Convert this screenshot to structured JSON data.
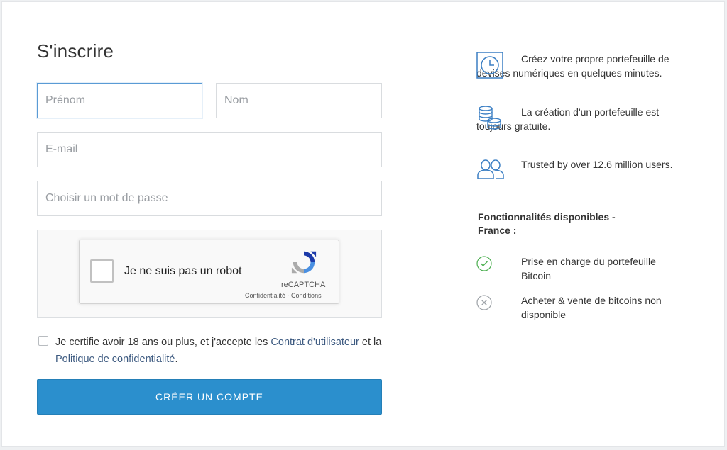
{
  "page": {
    "title": "S'inscrire"
  },
  "form": {
    "first_name_placeholder": "Prénom",
    "last_name_placeholder": "Nom",
    "email_placeholder": "E-mail",
    "password_placeholder": "Choisir un mot de passe",
    "submit_label": "CRÉER UN COMPTE"
  },
  "captcha": {
    "label": "Je ne suis pas un robot",
    "brand": "reCAPTCHA",
    "privacy_link": "Confidentialité",
    "separator": " - ",
    "terms_link": "Conditions"
  },
  "terms": {
    "text_1": "Je certifie avoir 18 ans ou plus, et j'accepte les ",
    "user_agreement_link": "Contrat d'utilisateur",
    "text_2": " et la ",
    "privacy_policy_link": "Politique de confidentialité",
    "text_3": "."
  },
  "features": [
    {
      "icon": "clock-icon",
      "text": "Créez votre propre portefeuille de devises numériques en quelques minutes."
    },
    {
      "icon": "coins-icon",
      "text": "La création d'un portefeuille est toujours gratuite."
    },
    {
      "icon": "users-icon",
      "text": "Trusted by over 12.6 million users."
    }
  ],
  "availability": {
    "title": "Fonctionnalités disponibles - France :",
    "items": [
      {
        "icon": "check-circle-icon",
        "text": "Prise en charge du portefeuille Bitcoin",
        "status": "available"
      },
      {
        "icon": "x-circle-icon",
        "text": "Acheter & vente de bitcoins non disponible",
        "status": "unavailable"
      }
    ]
  },
  "colors": {
    "accent": "#2b8fcd",
    "link": "#3d5a80",
    "icon_blue": "#3b7fc4",
    "check_green": "#4caf50",
    "x_gray": "#9ea3a8"
  }
}
